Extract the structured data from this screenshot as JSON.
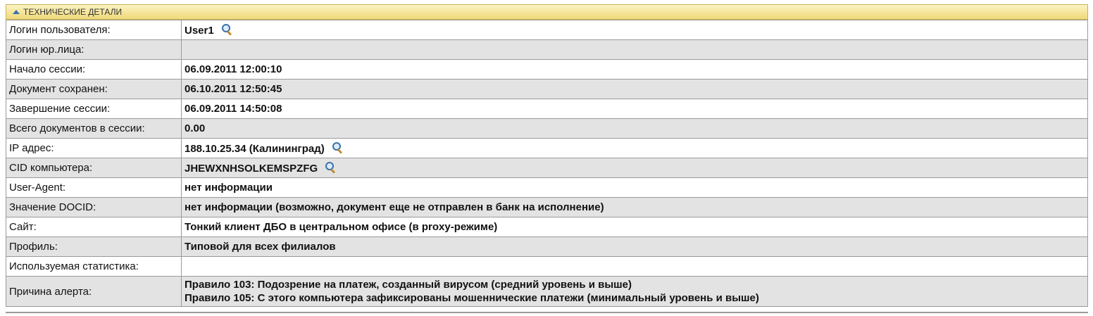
{
  "header": {
    "title": "ТЕХНИЧЕСКИЕ ДЕТАЛИ",
    "icon": "collapse-up-icon"
  },
  "rows": [
    {
      "label": "Логин пользователя:",
      "value": "User1"
    },
    {
      "label": "Логин юр.лица:",
      "value": ""
    },
    {
      "label": "Начало сессии:",
      "value": "06.09.2011 12:00:10"
    },
    {
      "label": "Документ сохранен:",
      "value": "06.10.2011 12:50:45"
    },
    {
      "label": "Завершение сессии:",
      "value": "06.09.2011 14:50:08"
    },
    {
      "label": "Всего документов в сессии:",
      "value": "0.00"
    },
    {
      "label": "IP адрес:",
      "value": "188.10.25.34 (Калининград)"
    },
    {
      "label": "CID компьютера:",
      "value": "JHEWXNHSOLKEMSPZFG"
    },
    {
      "label": "User-Agent:",
      "value": "нет информации"
    },
    {
      "label": "Значение DOCID:",
      "value": "нет информации (возможно, документ еще не отправлен в банк на исполнение)"
    },
    {
      "label": "Сайт:",
      "value": "Тонкий клиент ДБО в центральном офисе (в proxy-режиме)"
    },
    {
      "label": "Профиль:",
      "value": "Типовой для всех филиалов"
    },
    {
      "label": "Используемая статистика:",
      "value": ""
    },
    {
      "label": "Причина алерта:",
      "lines": [
        "Правило 103: Подозрение на платеж, созданный вирусом (средний уровень и выше)",
        "Правило 105: С этого компьютера зафиксированы мошеннические платежи (минимальный уровень и выше)"
      ]
    }
  ]
}
